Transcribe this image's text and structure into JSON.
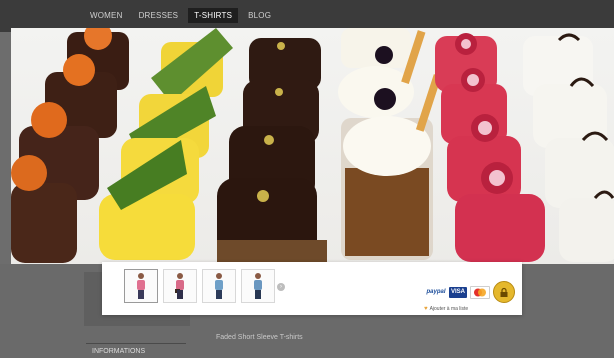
{
  "nav": {
    "items": [
      {
        "label": "WOMEN",
        "active": false
      },
      {
        "label": "DRESSES",
        "active": false
      },
      {
        "label": "T-SHIRTS",
        "active": true
      },
      {
        "label": "BLOG",
        "active": false
      }
    ]
  },
  "hero": {
    "alt": "Assorted pastry cakes"
  },
  "thumbnails": [
    {
      "icon": "model-pink-icon"
    },
    {
      "icon": "model-pink-2-icon"
    },
    {
      "icon": "model-blue-icon"
    },
    {
      "icon": "model-blue-2-icon"
    }
  ],
  "payment": {
    "paypal": "paypal",
    "visa": "VISA",
    "mastercard": "",
    "lock_icon": "lock-badge-icon"
  },
  "wishlist": {
    "label": "Ajouter à ma liste"
  },
  "product": {
    "title": "Faded Short Sleeve T-shirts"
  },
  "sections": {
    "informations": "INFORMATIONS"
  },
  "colors": {
    "nav_bg": "#3b3b3b",
    "overlay_bg": "#6d6d6d",
    "panel_bg": "#ffffff",
    "accent": "#e5b82d"
  }
}
